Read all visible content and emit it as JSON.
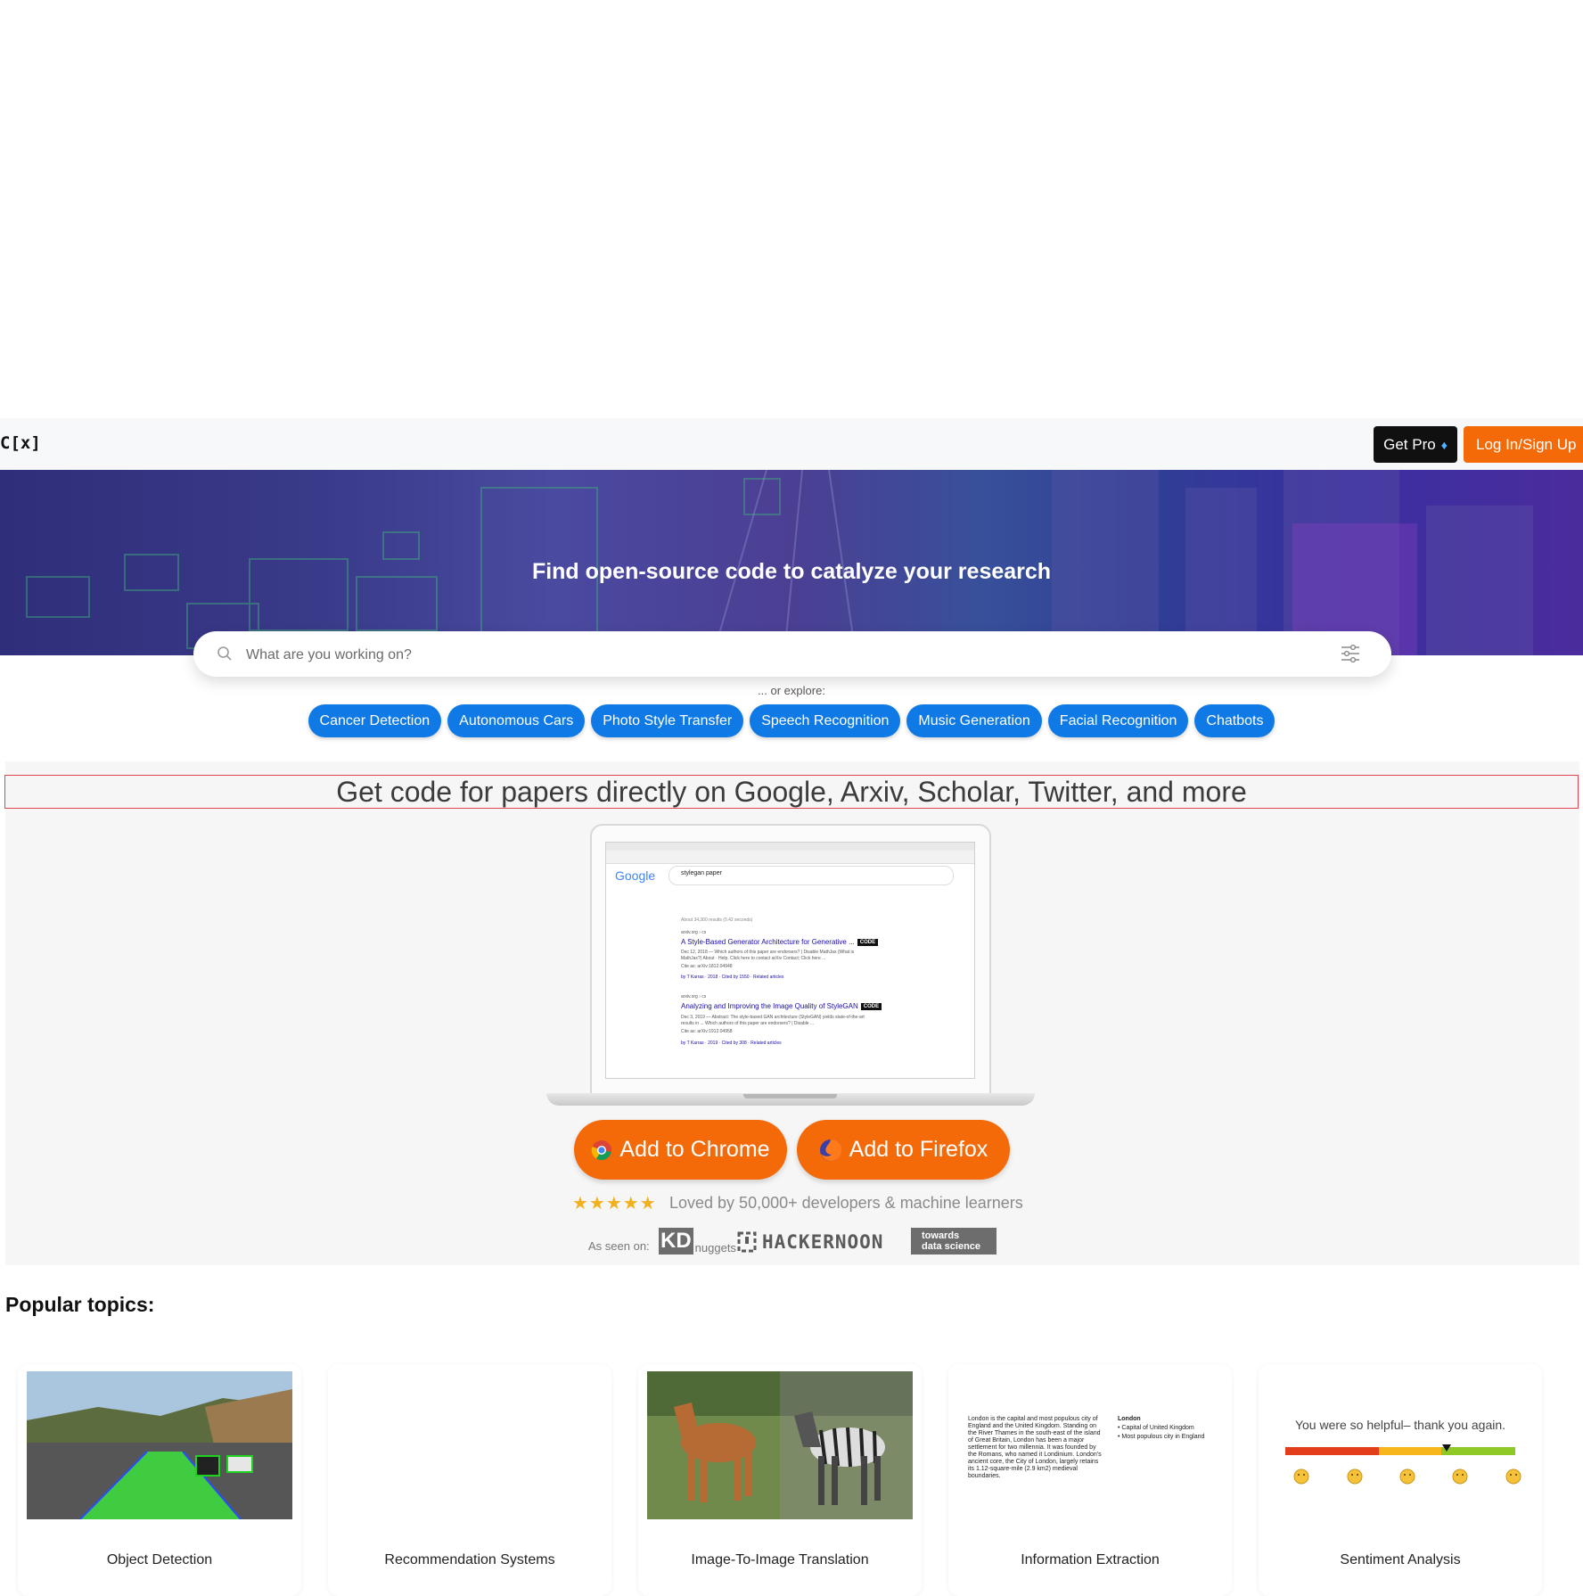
{
  "nav": {
    "logo": "C[x]",
    "get_pro": "Get Pro",
    "login": "Log In/Sign Up"
  },
  "hero": {
    "title": "Find open-source code to catalyze your research"
  },
  "search": {
    "placeholder": "What are you working on?"
  },
  "explore": {
    "label": "... or explore:",
    "chips": [
      "Cancer Detection",
      "Autonomous Cars",
      "Photo Style Transfer",
      "Speech Recognition",
      "Music Generation",
      "Facial Recognition",
      "Chatbots"
    ]
  },
  "extension": {
    "headline": "Get code for papers directly on Google, Arxiv, Scholar, Twitter, and more",
    "screenshot": {
      "google": "Google",
      "query": "stylegan paper",
      "results_count": "About 34,300 results (0.42 seconds)",
      "result1_src": "arxiv.org › cs",
      "result1_title": "A Style-Based Generator Architecture for Generative ...",
      "result1_snip1": "Dec 12, 2018 — Which authors of this paper are endorsers? | Disable MathJax (What is",
      "result1_snip2": "MathJax?) About · Help. Click here to contact arXiv Contact; Click here ...",
      "result1_cite": "Cite as: arXiv:1812.04948",
      "result1_meta": "by T Karras · 2018 · Cited by 1550 · Related articles",
      "result2_src": "arxiv.org › cs",
      "result2_title": "Analyzing and Improving the Image Quality of StyleGAN",
      "result2_snip1": "Dec 3, 2019 — Abstract: The style-based GAN architecture (StyleGAN) yields state-of-the-art",
      "result2_snip2": "results in ... Which authors of this paper are endorsers? | Disable ...",
      "result2_cite": "Cite as: arXiv:1912.04958",
      "result2_meta": "by T Karras · 2019 · Cited by 308 · Related articles",
      "code_badge": "CODE"
    },
    "add_chrome": "Add to Chrome",
    "add_firefox": "Add to Firefox",
    "stars": "★★★★★",
    "loved": "Loved by 50,000+ developers & machine learners",
    "seen_on": "As seen on:",
    "kd_main": "KD",
    "kd_sub": "nuggets",
    "hackernoon": "HACKERNOON",
    "tds_line1": "towards",
    "tds_line2": "data science"
  },
  "popular": {
    "title": "Popular topics:",
    "topics": [
      "Object Detection",
      "Recommendation Systems",
      "Image-To-Image Translation",
      "Information Extraction",
      "Sentiment Analysis"
    ],
    "info_extraction": {
      "text": "London is the capital and most populous city of England and the United Kingdom. Standing on the River Thames in the south-east of the island of Great Britain, London has been a major settlement for two millennia. It was founded by the Romans, who named it Londinium. London's ancient core, the City of London, largely retains its 1.12-square-mile (2.9 km2) medieval boundaries.",
      "entity": "London",
      "fact1": "• Capital of United Kingdom",
      "fact2": "• Most populous city in England"
    },
    "sentiment": {
      "quote": "You were so helpful– thank you again."
    }
  },
  "colors": {
    "accent_orange": "#f46a08",
    "chip_blue": "#0f7ae5",
    "dark_button": "#101010"
  }
}
